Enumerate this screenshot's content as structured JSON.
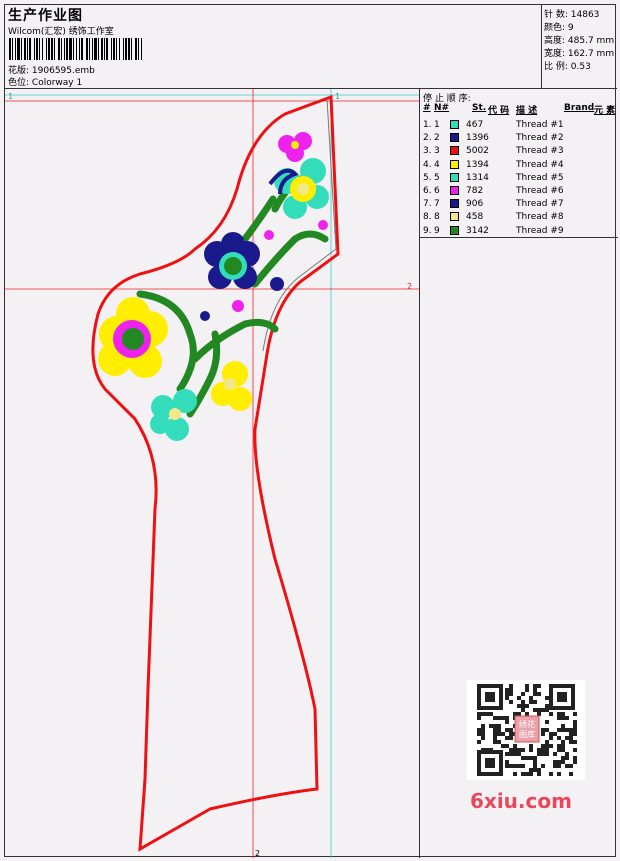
{
  "header": {
    "title": "生产作业图",
    "subtitle": "Wilcom(汇宏) 绣饰工作室",
    "design_label": "花版:",
    "design_value": "1906595.emb",
    "colorway_label": "色位:",
    "colorway_value": "Colorway 1"
  },
  "stats": [
    {
      "label": "针 数:",
      "value": "14863"
    },
    {
      "label": "颜色:",
      "value": "9"
    },
    {
      "label": "高度:",
      "value": "485.7 mm"
    },
    {
      "label": "宽度:",
      "value": "162.7 mm"
    },
    {
      "label": "比 例:",
      "value": "0.53"
    }
  ],
  "stop_sequence": {
    "title": "停 止 顺 序:",
    "headers": {
      "hash": "#",
      "no": "N#",
      "st": "St.",
      "code": "代 码",
      "desc": "描 述",
      "brand": "Brand",
      "element": "元 素"
    },
    "rows": [
      {
        "idx": "1.",
        "n": "1",
        "color": "#33ddbb",
        "code": "467",
        "desc": "Thread #1"
      },
      {
        "idx": "2.",
        "n": "2",
        "color": "#1a1a8c",
        "code": "1396",
        "desc": "Thread #2"
      },
      {
        "idx": "3.",
        "n": "3",
        "color": "#ee1111",
        "code": "5002",
        "desc": "Thread #3"
      },
      {
        "idx": "4.",
        "n": "4",
        "color": "#ffee00",
        "code": "1394",
        "desc": "Thread #4"
      },
      {
        "idx": "5.",
        "n": "5",
        "color": "#33ddbb",
        "code": "1314",
        "desc": "Thread #5"
      },
      {
        "idx": "6.",
        "n": "6",
        "color": "#ee22ee",
        "code": "782",
        "desc": "Thread #6"
      },
      {
        "idx": "7.",
        "n": "7",
        "color": "#1a1a8c",
        "code": "906",
        "desc": "Thread #7"
      },
      {
        "idx": "8.",
        "n": "8",
        "color": "#f2e88a",
        "code": "458",
        "desc": "Thread #8"
      },
      {
        "idx": "9.",
        "n": "9",
        "color": "#228822",
        "code": "3142",
        "desc": "Thread #9"
      }
    ]
  },
  "guides": {
    "top_left": "1",
    "top_right": "1",
    "mid_right": "2",
    "bottom": "2"
  },
  "watermark": {
    "text": "6xiu.com",
    "stamp": "绣花\n图库"
  }
}
